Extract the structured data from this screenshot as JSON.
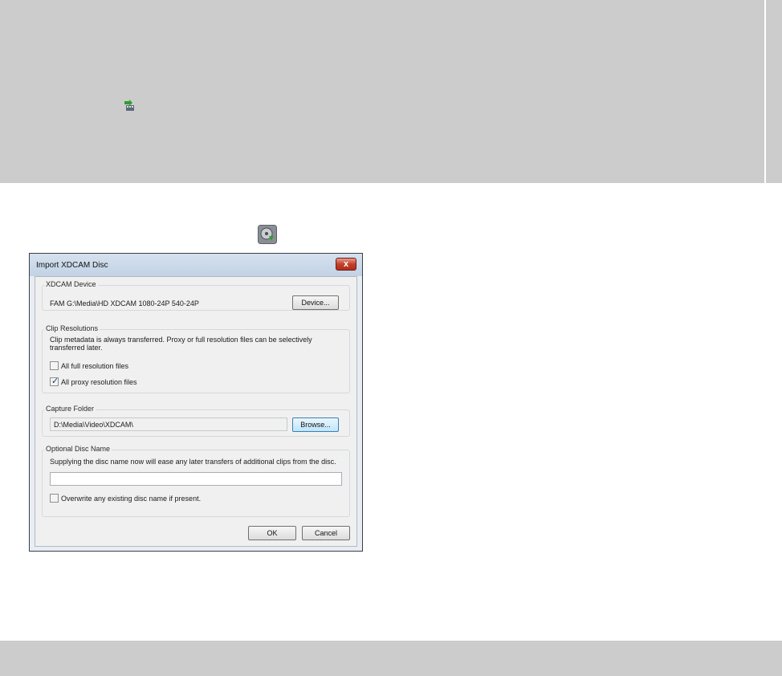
{
  "dialog": {
    "title": "Import XDCAM Disc",
    "close_label": "x",
    "xdcam_device": {
      "legend": "XDCAM Device",
      "device_path": "FAM G:\\Media\\HD XDCAM 1080-24P 540-24P",
      "device_button": "Device..."
    },
    "clip_resolutions": {
      "legend": "Clip Resolutions",
      "description": "Clip metadata is always transferred. Proxy or full resolution files can be selectively transferred later.",
      "full_res_label": "All full resolution files",
      "full_res_checked": false,
      "proxy_label": "All proxy resolution files",
      "proxy_checked": true
    },
    "capture_folder": {
      "legend": "Capture Folder",
      "path": "D:\\Media\\Video\\XDCAM\\",
      "browse_button": "Browse..."
    },
    "disc_name": {
      "legend": "Optional Disc Name",
      "description": "Supplying the disc name now will ease any later transfers of additional clips from the disc.",
      "value": "",
      "overwrite_label": "Overwrite any existing disc name if present.",
      "overwrite_checked": false
    },
    "ok_button": "OK",
    "cancel_button": "Cancel"
  },
  "icons": {
    "small": "import-clip-icon",
    "toolbar": "import-disc-icon"
  }
}
